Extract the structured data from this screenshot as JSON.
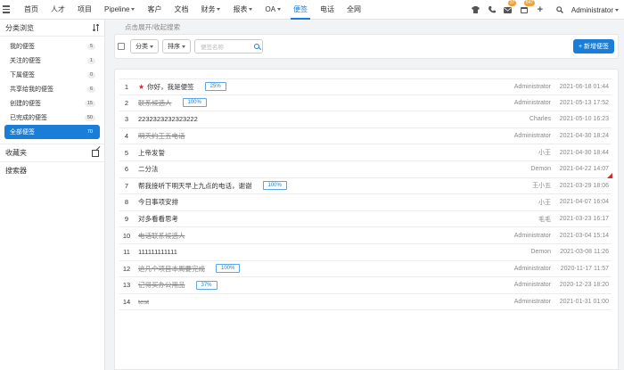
{
  "nav": {
    "items": [
      {
        "label": "首页",
        "dropdown": false,
        "active": false
      },
      {
        "label": "人才",
        "dropdown": false,
        "active": false
      },
      {
        "label": "项目",
        "dropdown": false,
        "active": false
      },
      {
        "label": "Pipeline",
        "dropdown": true,
        "active": false
      },
      {
        "label": "客户",
        "dropdown": false,
        "active": false
      },
      {
        "label": "文档",
        "dropdown": false,
        "active": false
      },
      {
        "label": "财务",
        "dropdown": true,
        "active": false
      },
      {
        "label": "报表",
        "dropdown": true,
        "active": false
      },
      {
        "label": "OA",
        "dropdown": true,
        "active": false
      },
      {
        "label": "便签",
        "dropdown": false,
        "active": true
      },
      {
        "label": "电话",
        "dropdown": false,
        "active": false
      },
      {
        "label": "全网",
        "dropdown": false,
        "active": false
      }
    ],
    "mail_badge": "37",
    "calendar_badge": "847",
    "plus": "+",
    "user": "Administrator"
  },
  "sidebar": {
    "title": "分类浏览",
    "items": [
      {
        "label": "我的便签",
        "count": "5",
        "active": false
      },
      {
        "label": "关注的便签",
        "count": "1",
        "active": false
      },
      {
        "label": "下属便签",
        "count": "0",
        "active": false
      },
      {
        "label": "共享给我的便签",
        "count": "6",
        "active": false
      },
      {
        "label": "创建的便签",
        "count": "15",
        "active": false
      },
      {
        "label": "已完成的便签",
        "count": "50",
        "active": false
      },
      {
        "label": "全部便签",
        "count": "70",
        "active": true
      }
    ],
    "favorites": "收藏夹",
    "search": "搜索器"
  },
  "toolbar": {
    "hint": "点击展开/收起搜索",
    "category": "分类",
    "sort": "排序",
    "search_placeholder": "便签名称",
    "new_button": "+ 新增便签"
  },
  "notes": [
    {
      "num": "1",
      "text": "你好，我是便签",
      "done": false,
      "star": true,
      "progress": "25%",
      "owner": "Administrator",
      "time": "2021-06-18 01:44",
      "corner": false
    },
    {
      "num": "2",
      "text": "联系候选人",
      "done": true,
      "star": false,
      "progress": "100%",
      "owner": "Administrator",
      "time": "2021-05-13 17:52",
      "corner": false
    },
    {
      "num": "3",
      "text": "2232323232323222",
      "done": false,
      "star": false,
      "progress": "",
      "owner": "Charles",
      "time": "2021-05-10 16:23",
      "corner": false
    },
    {
      "num": "4",
      "text": "明天约王五电话",
      "done": true,
      "star": false,
      "progress": "",
      "owner": "Administrator",
      "time": "2021-04-30 18:24",
      "corner": false
    },
    {
      "num": "5",
      "text": "上帝发誓",
      "done": false,
      "star": false,
      "progress": "",
      "owner": "小王",
      "time": "2021-04-30 18:44",
      "corner": false
    },
    {
      "num": "6",
      "text": "二分法",
      "done": false,
      "star": false,
      "progress": "",
      "owner": "Demon",
      "time": "2021-04-22 14:07",
      "corner": true
    },
    {
      "num": "7",
      "text": "帮我接听下明天早上九点的电话，谢谢",
      "done": false,
      "star": false,
      "progress": "100%",
      "owner": "王小五",
      "time": "2021-03-29 18:06",
      "corner": false
    },
    {
      "num": "8",
      "text": "今日事项安排",
      "done": false,
      "star": false,
      "progress": "",
      "owner": "小王",
      "time": "2021-04-07 16:04",
      "corner": false
    },
    {
      "num": "9",
      "text": "对多看看思考",
      "done": false,
      "star": false,
      "progress": "",
      "owner": "毛毛",
      "time": "2021-03-23 16:17",
      "corner": false
    },
    {
      "num": "10",
      "text": "电话联系候选人",
      "done": true,
      "star": false,
      "progress": "",
      "owner": "Administrator",
      "time": "2021-03-04 15:14",
      "corner": false
    },
    {
      "num": "11",
      "text": "111111111111",
      "done": false,
      "star": false,
      "progress": "",
      "owner": "Demon",
      "time": "2021-03-08 11:26",
      "corner": false
    },
    {
      "num": "12",
      "text": "这几个项目本周要完成",
      "done": true,
      "star": false,
      "progress": "100%",
      "owner": "Administrator",
      "time": "2020-11-17 11:57",
      "corner": false
    },
    {
      "num": "13",
      "text": "记得买办公用品",
      "done": true,
      "star": false,
      "progress": "37%",
      "owner": "Administrator",
      "time": "2020-12-23 18:20",
      "corner": false
    },
    {
      "num": "14",
      "text": "test",
      "done": true,
      "star": false,
      "progress": "",
      "owner": "Administrator",
      "time": "2021-01-31 01:00",
      "corner": false
    }
  ]
}
